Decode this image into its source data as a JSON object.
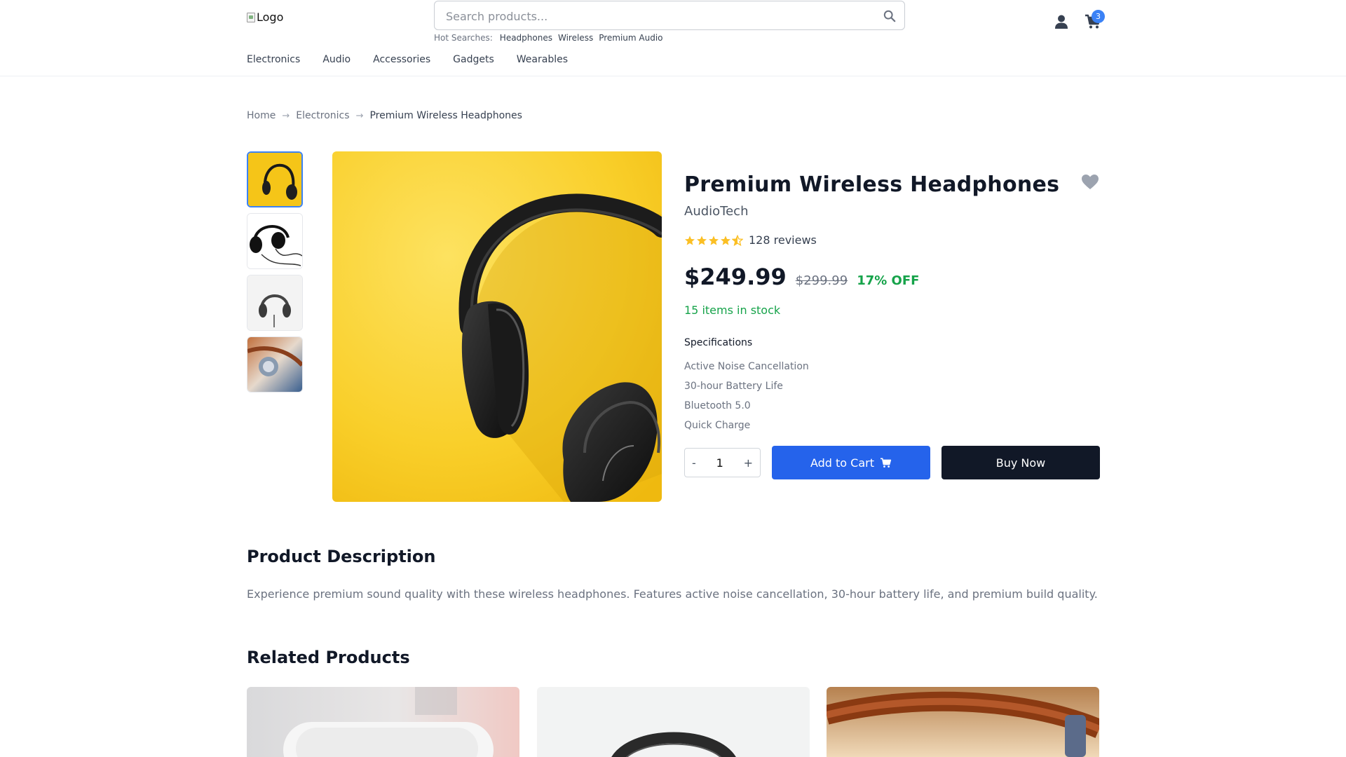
{
  "header": {
    "logo_alt": "Logo",
    "search_placeholder": "Search products...",
    "hot_label": "Hot Searches:",
    "hot_searches": [
      "Headphones",
      "Wireless",
      "Premium Audio"
    ],
    "cart_count": "3"
  },
  "nav": {
    "items": [
      {
        "label": "Electronics"
      },
      {
        "label": "Audio"
      },
      {
        "label": "Accessories"
      },
      {
        "label": "Gadgets"
      },
      {
        "label": "Wearables"
      }
    ]
  },
  "breadcrumb": {
    "home": "Home",
    "category": "Electronics",
    "current": "Premium Wireless Headphones",
    "separator": "→"
  },
  "product": {
    "title": "Premium Wireless Headphones",
    "brand": "AudioTech",
    "rating": 4.5,
    "reviews": "128 reviews",
    "price": "$249.99",
    "old_price": "$299.99",
    "discount": "17% OFF",
    "stock": "15 items in stock",
    "specs_title": "Specifications",
    "specs": [
      "Active Noise Cancellation",
      "30-hour Battery Life",
      "Bluetooth 5.0",
      "Quick Charge"
    ],
    "quantity": "1",
    "qty_minus": "-",
    "qty_plus": "+",
    "add_to_cart": "Add to Cart",
    "buy_now": "Buy Now"
  },
  "description": {
    "title": "Product Description",
    "text": "Experience premium sound quality with these wireless headphones. Features active noise cancellation, 30-hour battery life, and premium build quality."
  },
  "related": {
    "title": "Related Products"
  },
  "colors": {
    "accent": "#2563eb",
    "dark": "#111827",
    "success": "#16a34a",
    "star": "#fbbf24"
  }
}
